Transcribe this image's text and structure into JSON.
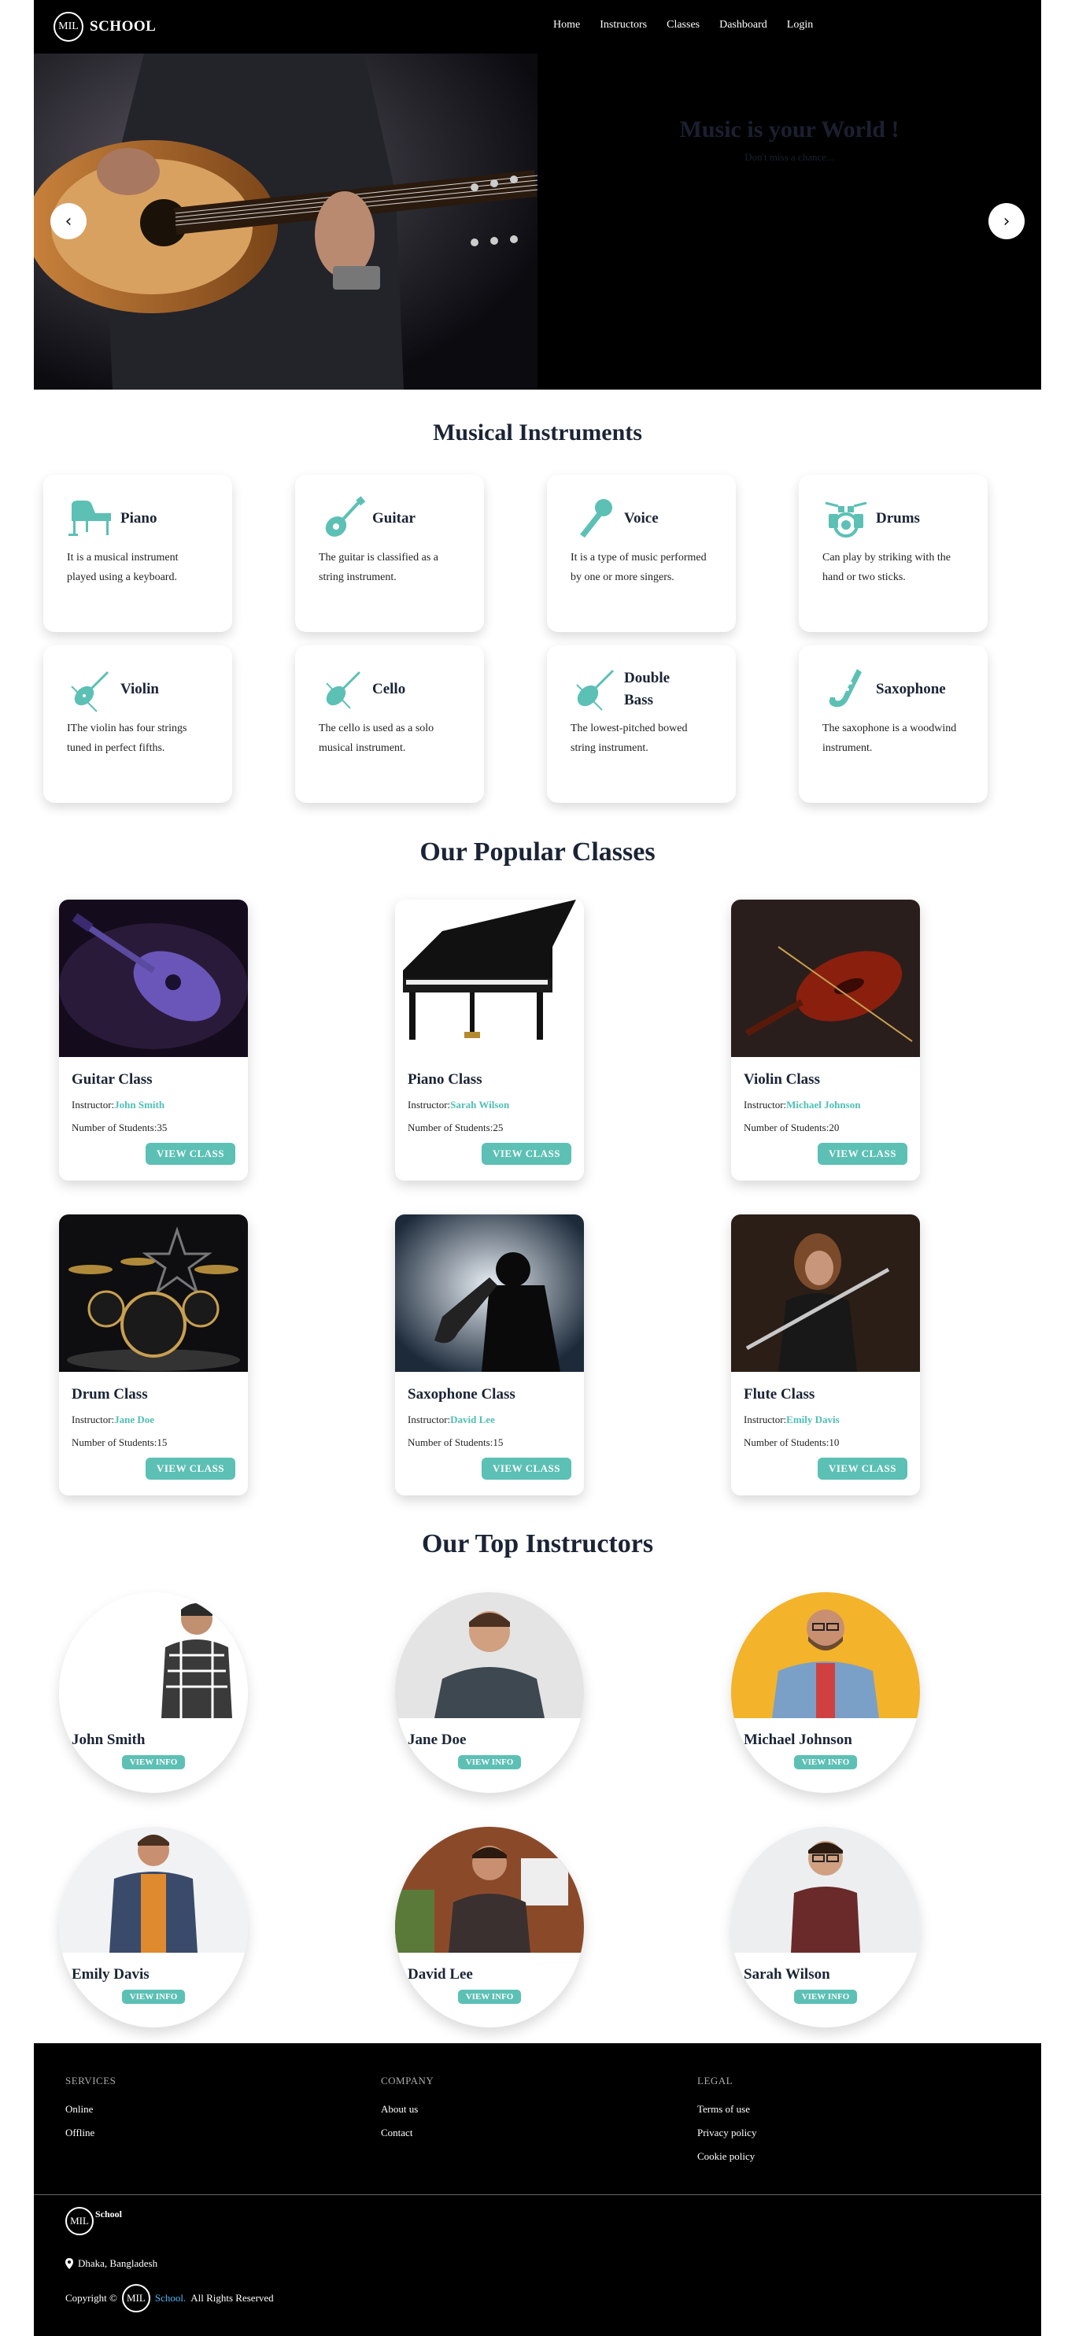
{
  "nav": {
    "logo_badge": "MIL",
    "brand": "SCHOOL",
    "links": [
      "Home",
      "Instructors",
      "Classes",
      "Dashboard",
      "Login"
    ]
  },
  "hero": {
    "title": "Music is your World !",
    "subtitle": "Don't miss a chance...",
    "prev": "‹",
    "next": "›"
  },
  "instruments": {
    "title": "Musical Instruments",
    "items": [
      {
        "name": "Piano",
        "desc": "It is a musical instrument played using a keyboard.",
        "icon": "piano-icon"
      },
      {
        "name": "Guitar",
        "desc": "The guitar is classified as a string instrument.",
        "icon": "guitar-icon"
      },
      {
        "name": "Voice",
        "desc": "It is a type of music performed by one or more singers.",
        "icon": "microphone-icon"
      },
      {
        "name": "Drums",
        "desc": "Can play by striking with the hand or two sticks.",
        "icon": "drums-icon"
      },
      {
        "name": "Violin",
        "desc": "IThe violin has four strings tuned in perfect fifths.",
        "icon": "violin-icon"
      },
      {
        "name": "Cello",
        "desc": "The cello is used as a solo musical instrument.",
        "icon": "cello-icon"
      },
      {
        "name": "Double Bass",
        "desc": "The lowest-pitched bowed string instrument.",
        "icon": "double-bass-icon"
      },
      {
        "name": "Saxophone",
        "desc": "The saxophone is a woodwind instrument.",
        "icon": "saxophone-icon"
      }
    ]
  },
  "classes": {
    "title": "Our Popular Classes",
    "instructor_label": "Instructor:",
    "students_label": "Number of Students:",
    "button": "VIEW CLASS",
    "items": [
      {
        "name": "Guitar Class",
        "instructor": "John Smith",
        "students": "35"
      },
      {
        "name": "Piano Class",
        "instructor": "Sarah Wilson",
        "students": "25"
      },
      {
        "name": "Violin Class",
        "instructor": "Michael Johnson",
        "students": "20"
      },
      {
        "name": "Drum Class",
        "instructor": "Jane Doe",
        "students": "15"
      },
      {
        "name": "Saxophone Class",
        "instructor": "David Lee",
        "students": "15"
      },
      {
        "name": "Flute Class",
        "instructor": "Emily Davis",
        "students": "10"
      }
    ]
  },
  "instructors": {
    "title": "Our Top Instructors",
    "button": "VIEW INFO",
    "items": [
      {
        "name": "John Smith"
      },
      {
        "name": "Jane Doe"
      },
      {
        "name": "Michael Johnson"
      },
      {
        "name": "Emily Davis"
      },
      {
        "name": "David Lee"
      },
      {
        "name": "Sarah Wilson"
      }
    ]
  },
  "footer": {
    "services": {
      "title": "SERVICES",
      "links": [
        "Online",
        "Offline"
      ]
    },
    "company": {
      "title": "COMPANY",
      "links": [
        "About us",
        "Contact"
      ]
    },
    "legal": {
      "title": "LEGAL",
      "links": [
        "Terms of use",
        "Privacy policy",
        "Cookie policy"
      ]
    },
    "logo_badge": "MIL",
    "logo_text": "School",
    "location": "Dhaka, Bangladesh",
    "copyright_prefix": "Copyright ©",
    "copyright_brand": "School.",
    "copyright_suffix": "All Rights Reserved"
  },
  "colors": {
    "accent": "#5cc0b5",
    "dark": "#000000",
    "heading": "#1b2436"
  }
}
